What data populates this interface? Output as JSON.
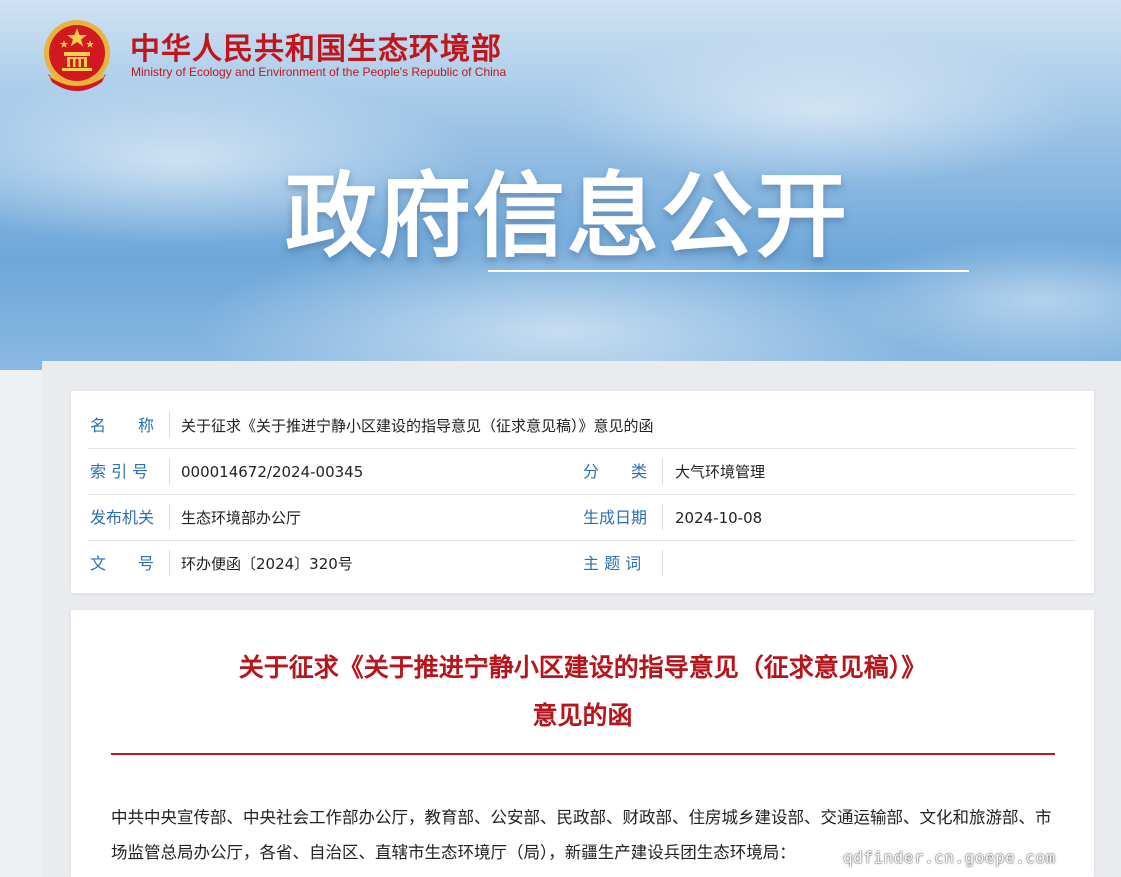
{
  "header": {
    "org_name_cn": "中华人民共和国生态环境部",
    "org_name_en": "Ministry of Ecology and Environment of the People's Republic of China",
    "banner_title": "政府信息公开"
  },
  "meta": {
    "name_label": "名　　称",
    "name_value": "关于征求《关于推进宁静小区建设的指导意见（征求意见稿）》意见的函",
    "index_label": "索 引 号",
    "index_value": "000014672/2024-00345",
    "category_label": "分　　类",
    "category_value": "大气环境管理",
    "issuer_label": "发布机关",
    "issuer_value": "生态环境部办公厅",
    "date_label": "生成日期",
    "date_value": "2024-10-08",
    "docno_label": "文　　号",
    "docno_value": "环办便函〔2024〕320号",
    "keywords_label": "主 题 词",
    "keywords_value": ""
  },
  "document": {
    "title_line1": "关于征求《关于推进宁静小区建设的指导意见（征求意见稿）》",
    "title_line2": "意见的函",
    "body_text": "中共中央宣传部、中央社会工作部办公厅，教育部、公安部、民政部、财政部、住房城乡建设部、交通运输部、文化和旅游部、市场监管总局办公厅，各省、自治区、直辖市生态环境厅（局），新疆生产建设兵团生态环境局："
  },
  "watermark": "qdfinder.cn.goepe.com",
  "colors": {
    "brand_red": "#c0161b",
    "label_blue": "#2c6fb7",
    "title_red": "#b8141b"
  }
}
